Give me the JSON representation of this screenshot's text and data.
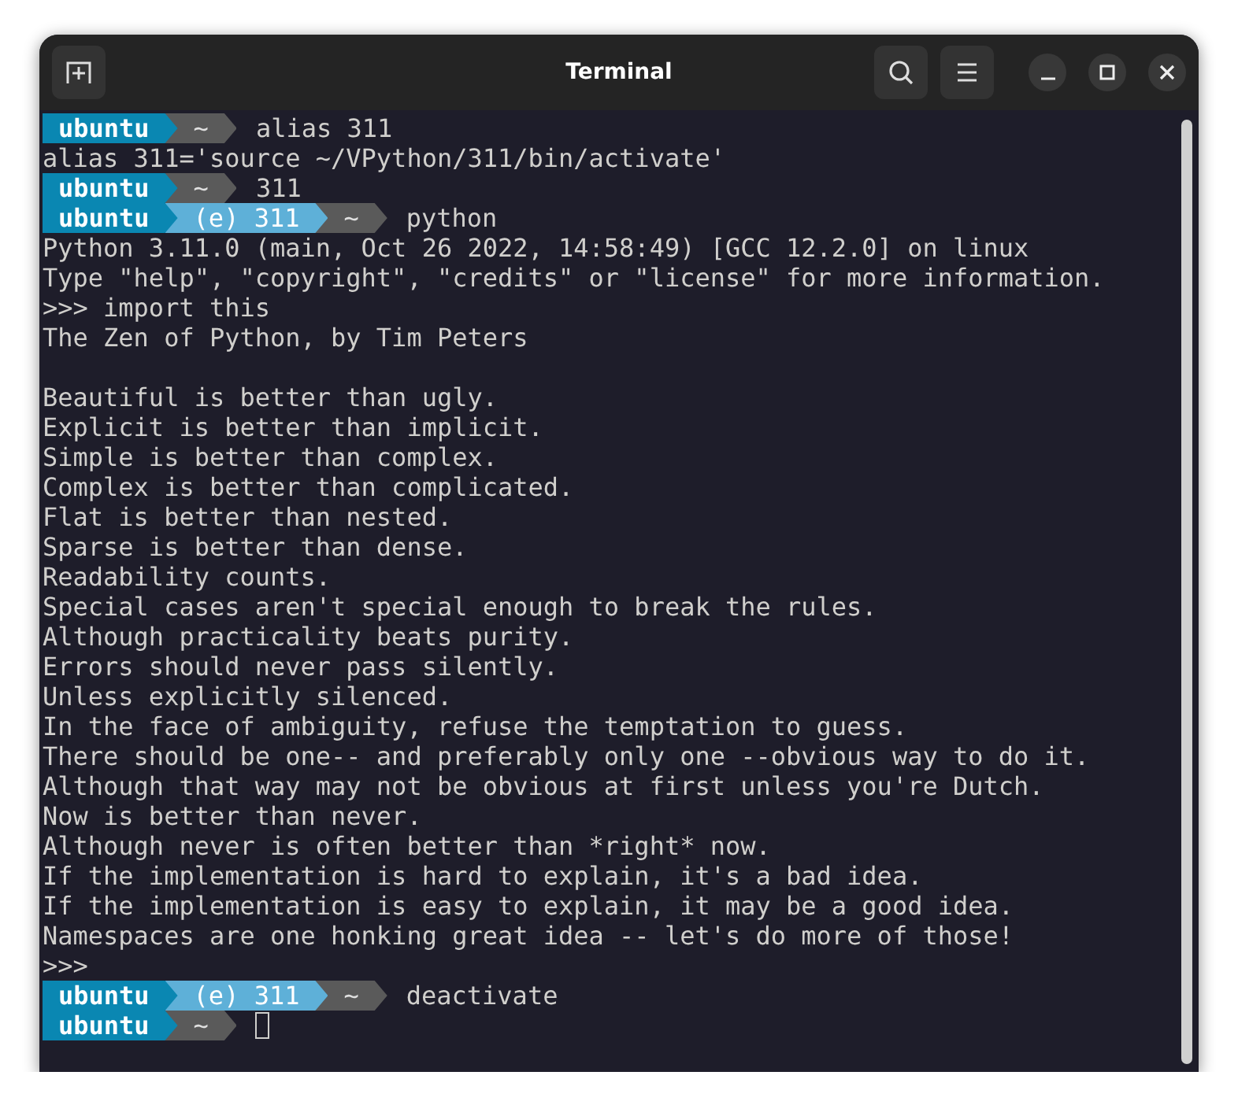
{
  "window": {
    "title": "Terminal"
  },
  "lines": [
    {
      "kind": "prompt",
      "segments": [
        {
          "kind": "user",
          "text": "ubuntu"
        },
        {
          "kind": "dir",
          "text": "~"
        }
      ],
      "command": "alias 311"
    },
    {
      "kind": "output",
      "text": "alias 311='source ~/VPython/311/bin/activate'"
    },
    {
      "kind": "prompt",
      "segments": [
        {
          "kind": "user",
          "text": "ubuntu"
        },
        {
          "kind": "dir",
          "text": "~"
        }
      ],
      "command": "311"
    },
    {
      "kind": "prompt",
      "segments": [
        {
          "kind": "user",
          "text": "ubuntu"
        },
        {
          "kind": "env",
          "text": "(e) 311"
        },
        {
          "kind": "dir",
          "text": "~"
        }
      ],
      "command": "python"
    },
    {
      "kind": "output",
      "text": "Python 3.11.0 (main, Oct 26 2022, 14:58:49) [GCC 12.2.0] on linux"
    },
    {
      "kind": "output",
      "text": "Type \"help\", \"copyright\", \"credits\" or \"license\" for more information."
    },
    {
      "kind": "output",
      "text": ">>> import this"
    },
    {
      "kind": "output",
      "text": "The Zen of Python, by Tim Peters"
    },
    {
      "kind": "blank"
    },
    {
      "kind": "output",
      "text": "Beautiful is better than ugly."
    },
    {
      "kind": "output",
      "text": "Explicit is better than implicit."
    },
    {
      "kind": "output",
      "text": "Simple is better than complex."
    },
    {
      "kind": "output",
      "text": "Complex is better than complicated."
    },
    {
      "kind": "output",
      "text": "Flat is better than nested."
    },
    {
      "kind": "output",
      "text": "Sparse is better than dense."
    },
    {
      "kind": "output",
      "text": "Readability counts."
    },
    {
      "kind": "output",
      "text": "Special cases aren't special enough to break the rules."
    },
    {
      "kind": "output",
      "text": "Although practicality beats purity."
    },
    {
      "kind": "output",
      "text": "Errors should never pass silently."
    },
    {
      "kind": "output",
      "text": "Unless explicitly silenced."
    },
    {
      "kind": "output",
      "text": "In the face of ambiguity, refuse the temptation to guess."
    },
    {
      "kind": "output",
      "text": "There should be one-- and preferably only one --obvious way to do it."
    },
    {
      "kind": "output",
      "text": "Although that way may not be obvious at first unless you're Dutch."
    },
    {
      "kind": "output",
      "text": "Now is better than never."
    },
    {
      "kind": "output",
      "text": "Although never is often better than *right* now."
    },
    {
      "kind": "output",
      "text": "If the implementation is hard to explain, it's a bad idea."
    },
    {
      "kind": "output",
      "text": "If the implementation is easy to explain, it may be a good idea."
    },
    {
      "kind": "output",
      "text": "Namespaces are one honking great idea -- let's do more of those!"
    },
    {
      "kind": "output",
      "text": ">>>"
    },
    {
      "kind": "prompt",
      "segments": [
        {
          "kind": "user",
          "text": "ubuntu"
        },
        {
          "kind": "env",
          "text": "(e) 311"
        },
        {
          "kind": "dir",
          "text": "~"
        }
      ],
      "command": "deactivate"
    },
    {
      "kind": "prompt",
      "segments": [
        {
          "kind": "user",
          "text": "ubuntu"
        },
        {
          "kind": "dir",
          "text": "~"
        }
      ],
      "cursor": true
    }
  ]
}
